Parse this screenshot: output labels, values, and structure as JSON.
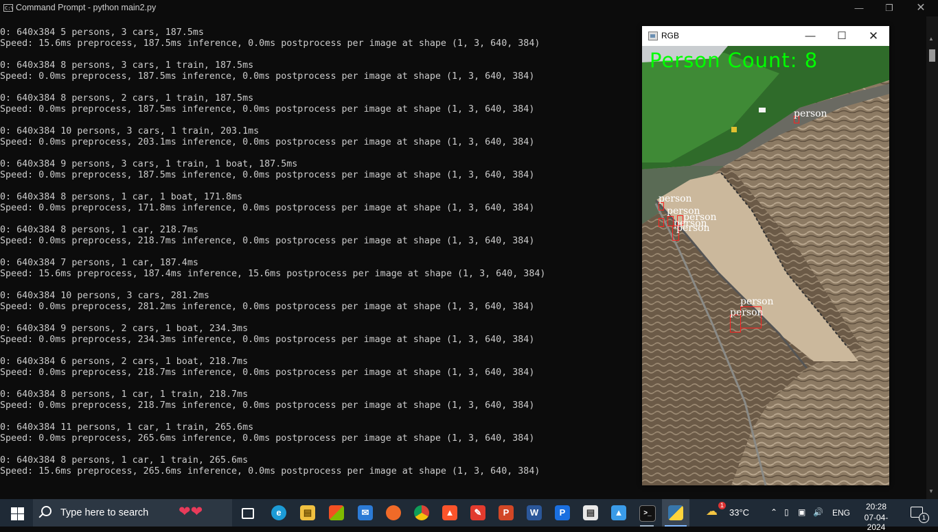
{
  "window": {
    "title": "Command Prompt - python  main2.py",
    "icon_text": "C:\\"
  },
  "console": {
    "lines": [
      "0: 640x384 5 persons, 3 cars, 187.5ms",
      "Speed: 15.6ms preprocess, 187.5ms inference, 0.0ms postprocess per image at shape (1, 3, 640, 384)",
      "",
      "0: 640x384 8 persons, 3 cars, 1 train, 187.5ms",
      "Speed: 0.0ms preprocess, 187.5ms inference, 0.0ms postprocess per image at shape (1, 3, 640, 384)",
      "",
      "0: 640x384 8 persons, 2 cars, 1 train, 187.5ms",
      "Speed: 0.0ms preprocess, 187.5ms inference, 0.0ms postprocess per image at shape (1, 3, 640, 384)",
      "",
      "0: 640x384 10 persons, 3 cars, 1 train, 203.1ms",
      "Speed: 0.0ms preprocess, 203.1ms inference, 0.0ms postprocess per image at shape (1, 3, 640, 384)",
      "",
      "0: 640x384 9 persons, 3 cars, 1 train, 1 boat, 187.5ms",
      "Speed: 0.0ms preprocess, 187.5ms inference, 0.0ms postprocess per image at shape (1, 3, 640, 384)",
      "",
      "0: 640x384 8 persons, 1 car, 1 boat, 171.8ms",
      "Speed: 0.0ms preprocess, 171.8ms inference, 0.0ms postprocess per image at shape (1, 3, 640, 384)",
      "",
      "0: 640x384 8 persons, 1 car, 218.7ms",
      "Speed: 0.0ms preprocess, 218.7ms inference, 0.0ms postprocess per image at shape (1, 3, 640, 384)",
      "",
      "0: 640x384 7 persons, 1 car, 187.4ms",
      "Speed: 15.6ms preprocess, 187.4ms inference, 15.6ms postprocess per image at shape (1, 3, 640, 384)",
      "",
      "0: 640x384 10 persons, 3 cars, 281.2ms",
      "Speed: 0.0ms preprocess, 281.2ms inference, 0.0ms postprocess per image at shape (1, 3, 640, 384)",
      "",
      "0: 640x384 9 persons, 2 cars, 1 boat, 234.3ms",
      "Speed: 0.0ms preprocess, 234.3ms inference, 0.0ms postprocess per image at shape (1, 3, 640, 384)",
      "",
      "0: 640x384 6 persons, 2 cars, 1 boat, 218.7ms",
      "Speed: 0.0ms preprocess, 218.7ms inference, 0.0ms postprocess per image at shape (1, 3, 640, 384)",
      "",
      "0: 640x384 8 persons, 1 car, 1 train, 218.7ms",
      "Speed: 0.0ms preprocess, 218.7ms inference, 0.0ms postprocess per image at shape (1, 3, 640, 384)",
      "",
      "0: 640x384 11 persons, 1 car, 1 train, 265.6ms",
      "Speed: 0.0ms preprocess, 265.6ms inference, 0.0ms postprocess per image at shape (1, 3, 640, 384)",
      "",
      "0: 640x384 8 persons, 1 car, 1 train, 265.6ms",
      "Speed: 15.6ms preprocess, 265.6ms inference, 0.0ms postprocess per image at shape (1, 3, 640, 384)"
    ]
  },
  "rgb_window": {
    "title": "RGB",
    "person_count": "Person Count: 8",
    "detection_label": "person",
    "detection_count": 8
  },
  "taskbar": {
    "search_placeholder": "Type here to search",
    "weather_temp": "33°C",
    "language": "ENG",
    "time": "20:28",
    "date": "07-04-2024",
    "notification_count": "1",
    "weather_badge": "1",
    "apps": [
      "task-view",
      "edge",
      "file-explorer",
      "microsoft-store",
      "mail",
      "firefox",
      "chrome",
      "brave",
      "draw",
      "powerpoint",
      "word",
      "pdf-app",
      "file-app",
      "azure",
      "terminal",
      "python"
    ]
  },
  "colors": {
    "console_bg": "#0c0c0c",
    "console_text": "#cccccc",
    "count_text": "#00ff00",
    "bbox": "#ff2020",
    "taskbar_bg": "#1f2a36"
  }
}
